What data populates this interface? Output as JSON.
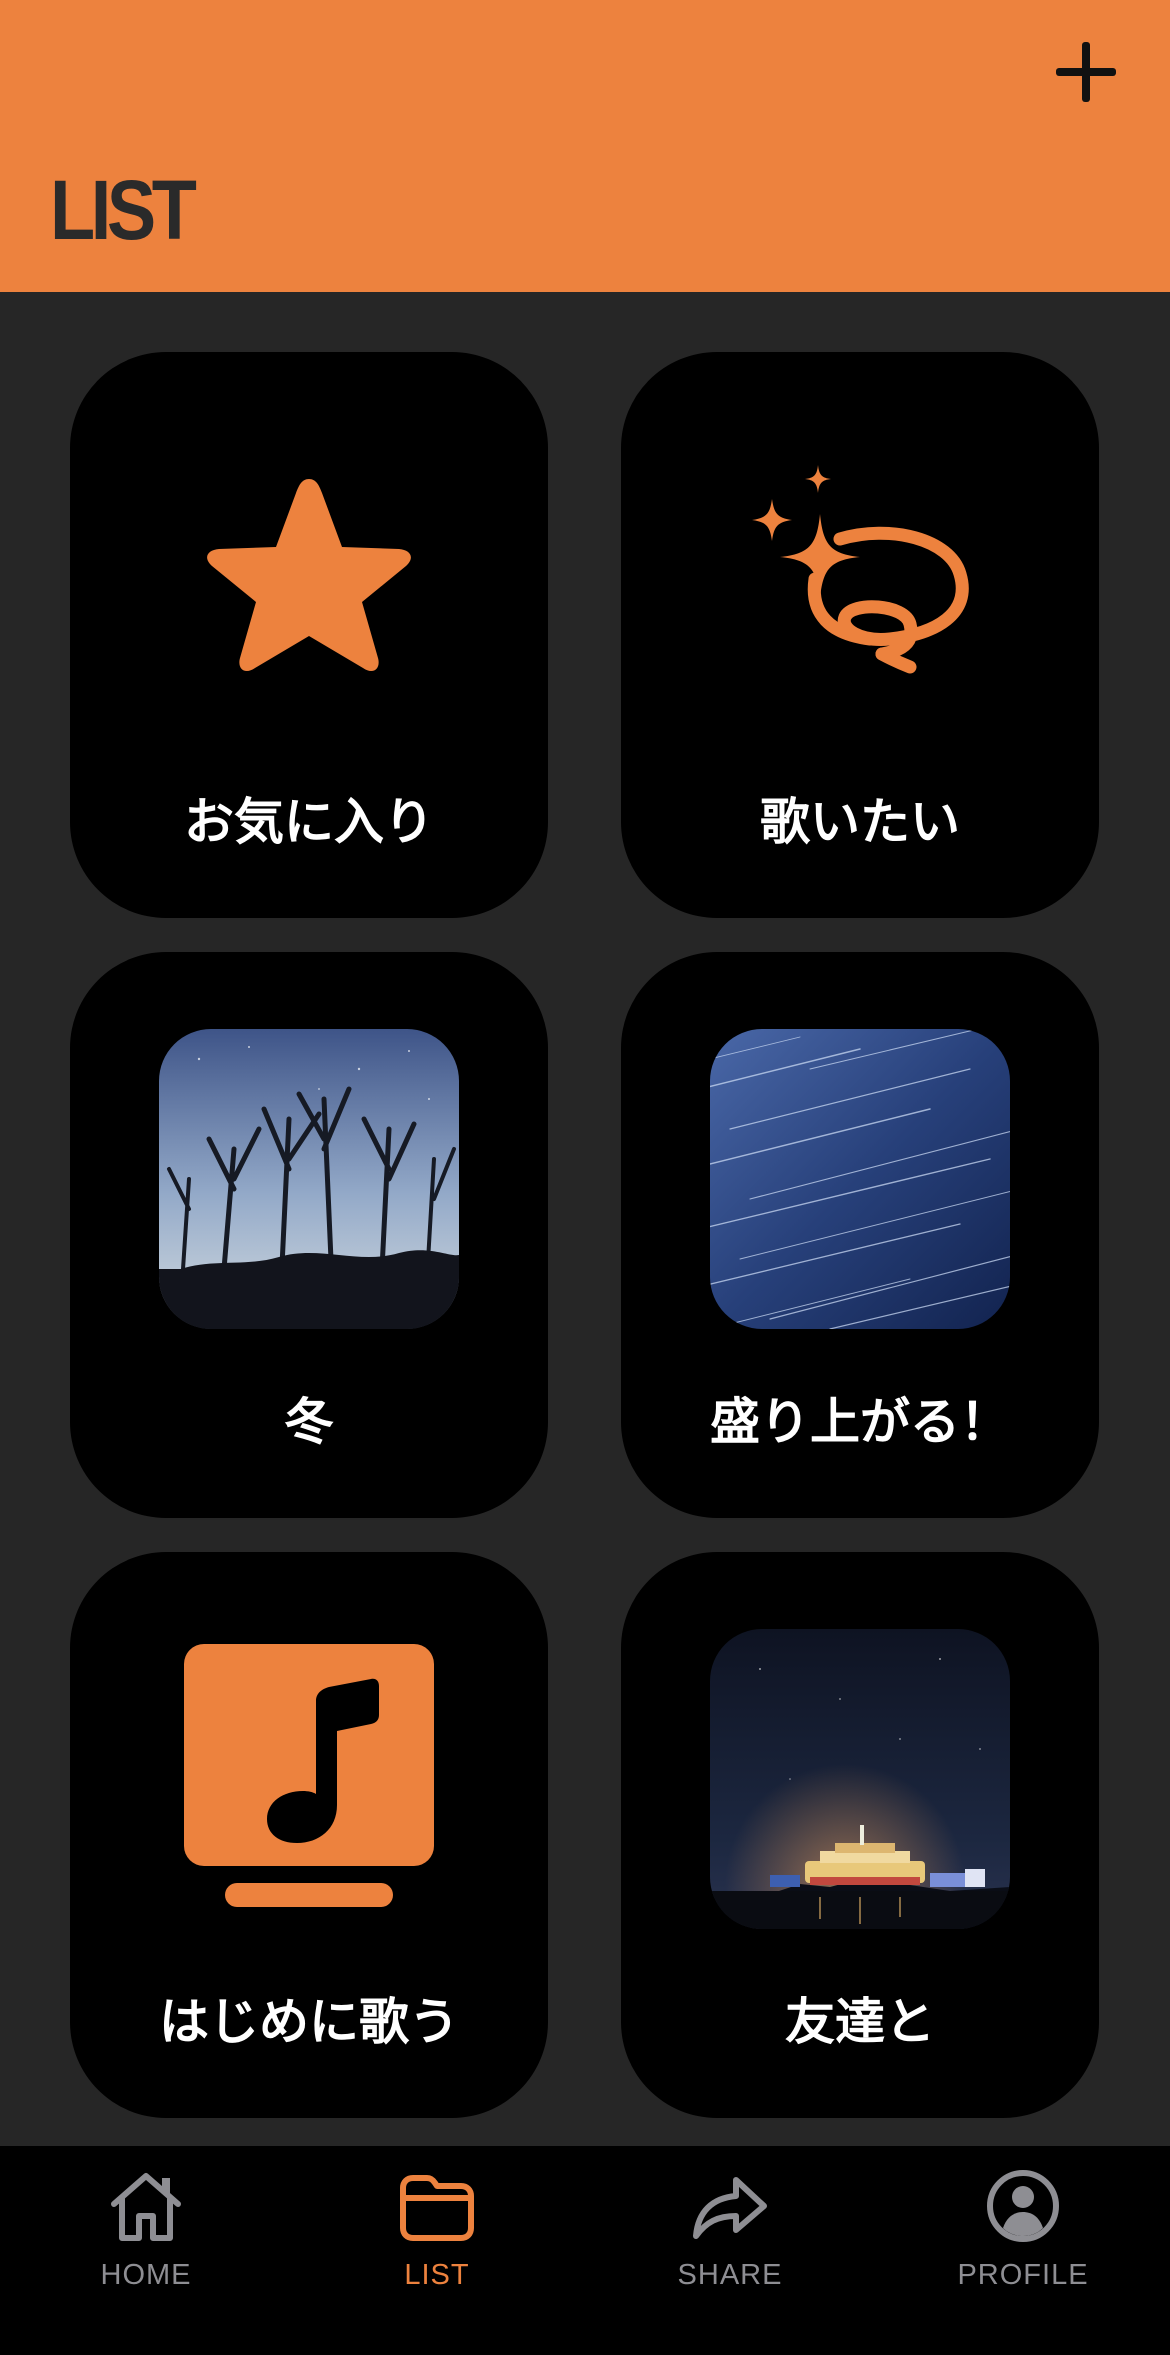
{
  "header": {
    "title": "LIST",
    "add_icon": "plus-icon"
  },
  "colors": {
    "accent": "#ED823E",
    "background": "#262626",
    "card": "#000000",
    "tab_inactive": "#8E8E93"
  },
  "playlists": [
    {
      "label": "お気に入り",
      "icon": "star-icon"
    },
    {
      "label": "歌いたい",
      "icon": "sparkles-loop-icon"
    },
    {
      "label": "冬",
      "image": "winter-trees-photo"
    },
    {
      "label": "盛り上がる！",
      "image": "star-trails-photo"
    },
    {
      "label": "はじめに歌う",
      "icon": "music-note-icon"
    },
    {
      "label": "友達と",
      "image": "night-ship-photo"
    }
  ],
  "tabbar": {
    "tabs": [
      {
        "label": "HOME",
        "icon": "house-icon",
        "active": false
      },
      {
        "label": "LIST",
        "icon": "folder-icon",
        "active": true
      },
      {
        "label": "SHARE",
        "icon": "share-arrow-icon",
        "active": false
      },
      {
        "label": "PROFILE",
        "icon": "person-circle-icon",
        "active": false
      }
    ]
  }
}
